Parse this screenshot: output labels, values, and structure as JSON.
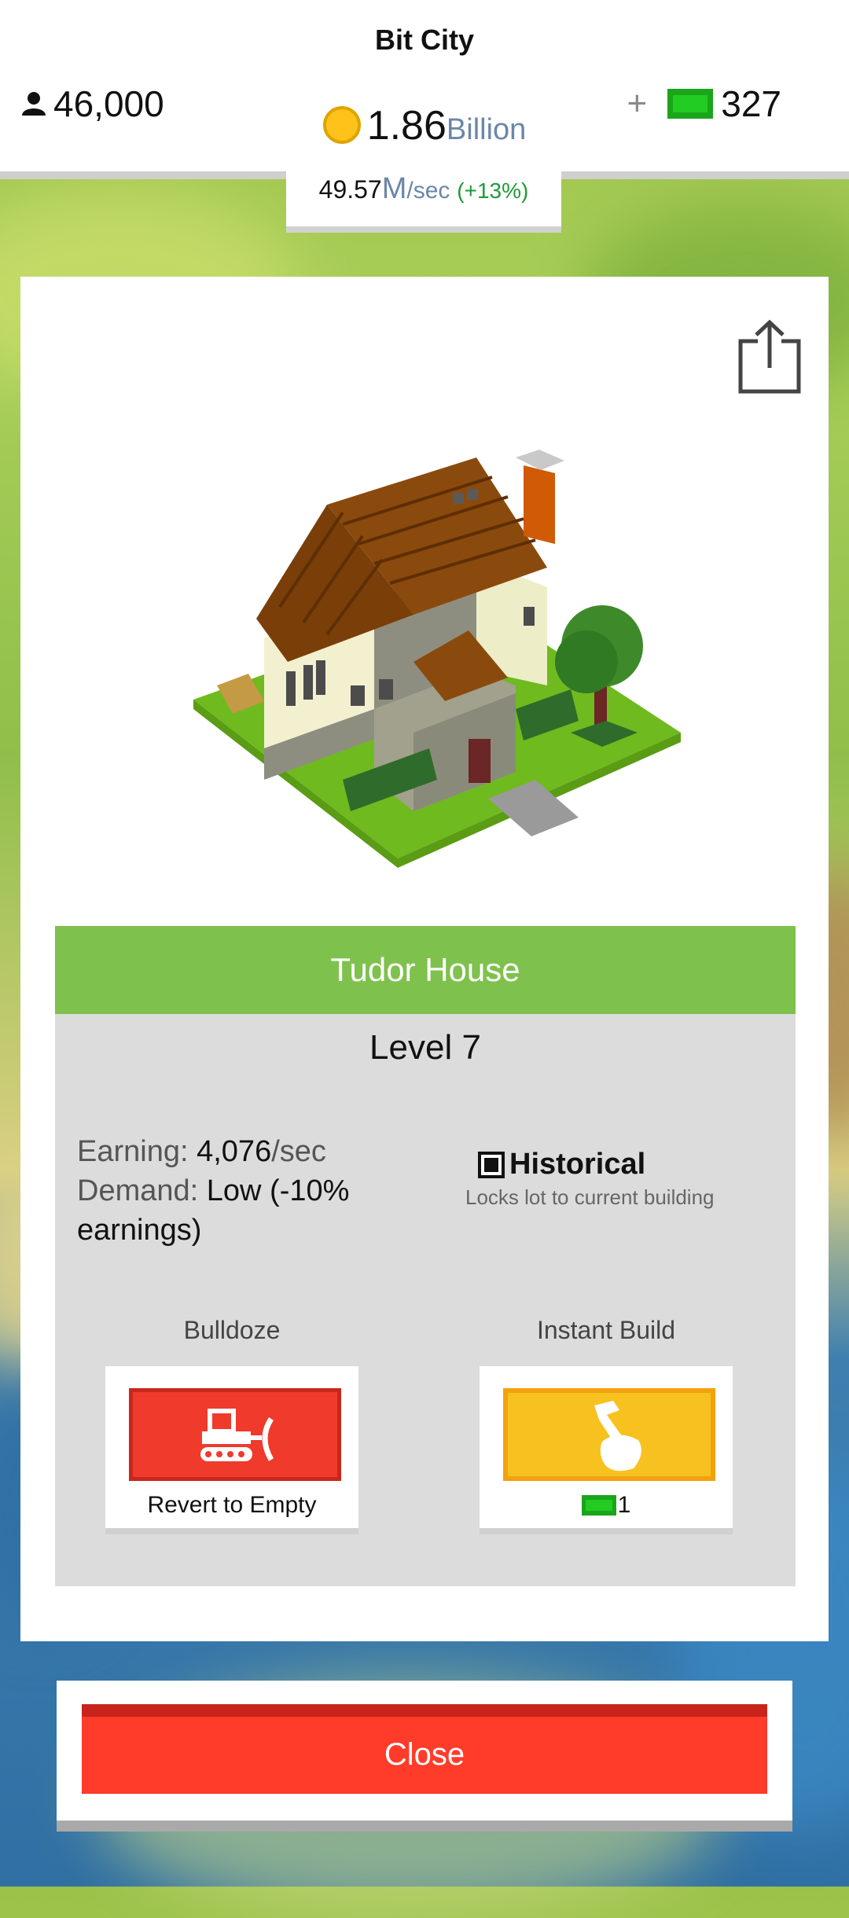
{
  "header": {
    "title": "Bit City",
    "population": "46,000",
    "cash_plus": "+",
    "cash": "327",
    "coins_value": "1.86",
    "coins_unit": "Billion",
    "rate_value": "49.57",
    "rate_unit": "M",
    "rate_suffix": "/sec",
    "rate_change": "(+13%)"
  },
  "building": {
    "name": "Tudor House",
    "level": "Level 7",
    "earning_label": "Earning:",
    "earning_value": "4,076",
    "earning_unit": "/sec",
    "demand_label": "Demand:",
    "demand_value": "Low (-10% earnings)",
    "historical_label": "Historical",
    "historical_desc": "Locks lot to current building"
  },
  "actions": {
    "bulldoze_label": "Bulldoze",
    "bulldoze_caption": "Revert to Empty",
    "instant_label": "Instant Build",
    "instant_cost": "1"
  },
  "footer": {
    "close_label": "Close"
  },
  "colors": {
    "title_bar": "#7fc14d",
    "bulldoze": "#ef3a2c",
    "instant": "#f7c21f",
    "close": "#ff3b2a"
  },
  "icons": [
    "person-icon",
    "coin-icon",
    "cash-icon",
    "share-icon",
    "bulldozer-icon",
    "hammer-hand-icon",
    "checkbox-icon"
  ]
}
